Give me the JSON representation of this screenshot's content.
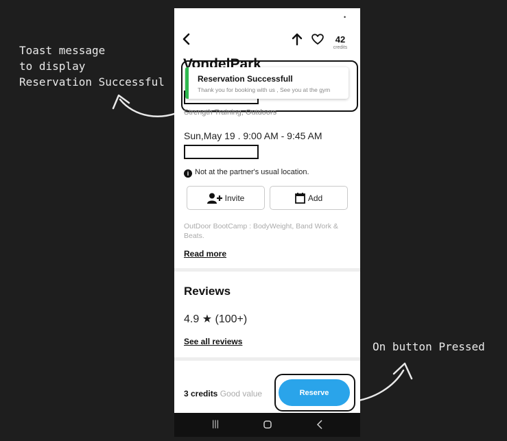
{
  "annotations": {
    "toast_note": "Toast message\nto display\nReservation Successful",
    "button_note": "On button Pressed"
  },
  "header": {
    "credits_value": "42",
    "credits_label": "credits"
  },
  "class": {
    "title": "VondelPark",
    "category": "Strength Training, Outdoors",
    "datetime": "Sun,May 19 . 9:00 AM - 9:45 AM",
    "notice": "Not at the partner's usual location.",
    "description": "OutDoor BootCamp : BodyWeight, Band Work & Beats.",
    "read_more": "Read more"
  },
  "toast": {
    "title": "Reservation Successfull",
    "message": "Thank you for booking with us , See you at the gym",
    "accent_color": "#2fb84f"
  },
  "actions": {
    "invite_label": "Invite",
    "add_label": "Add"
  },
  "reviews": {
    "heading": "Reviews",
    "rating": "4.9",
    "count": "(100+)",
    "see_all": "See all reviews"
  },
  "footer": {
    "credits": "3 credits",
    "value_label": "Good value",
    "reserve_label": "Reserve",
    "reserve_color": "#2aa4ea"
  },
  "icons": [
    "back-arrow-icon",
    "share-icon",
    "heart-icon",
    "info-icon",
    "add-user-icon",
    "calendar-icon",
    "star-icon",
    "recent-apps-icon",
    "home-icon",
    "back-icon"
  ]
}
